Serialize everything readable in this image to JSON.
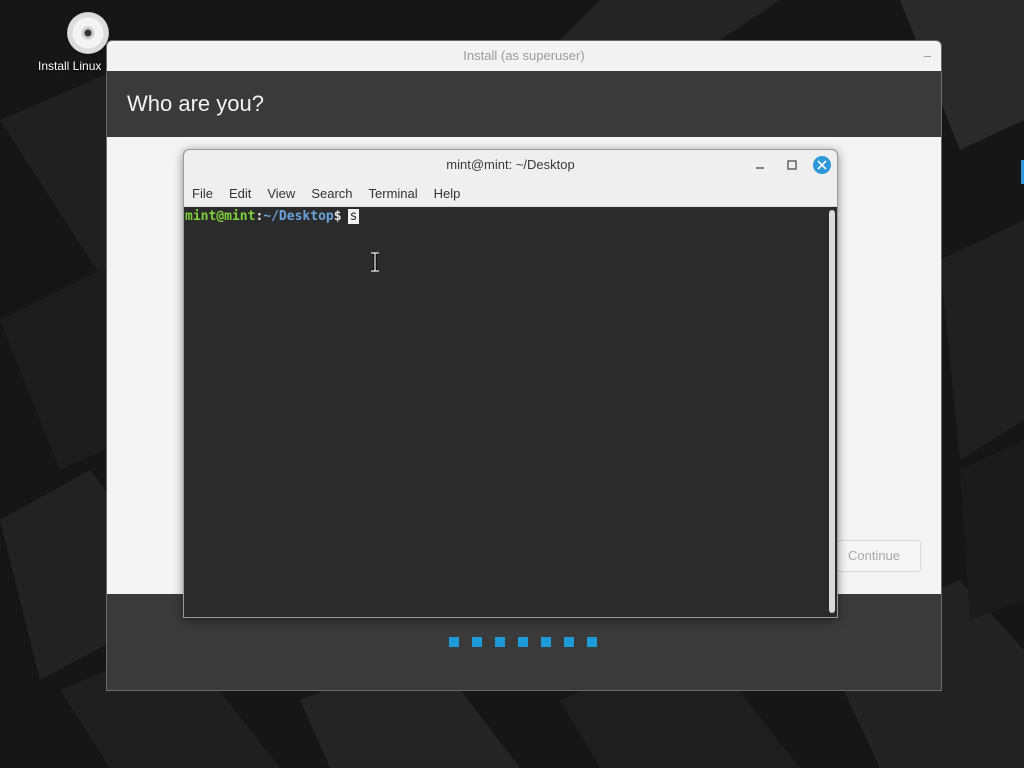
{
  "desktop": {
    "icon_label": "Install Linux"
  },
  "installer": {
    "title": "Install (as superuser)",
    "minimize_glyph": "–",
    "heading": "Who are you?",
    "continue_label": "Continue",
    "progress_steps_total": 7,
    "accent_color": "#1e9ad6"
  },
  "terminal": {
    "title": "mint@mint: ~/Desktop",
    "menu": [
      "File",
      "Edit",
      "View",
      "Search",
      "Terminal",
      "Help"
    ],
    "prompt": {
      "user_host": "mint@mint",
      "colon": ":",
      "path": "~/Desktop",
      "dollar": "$",
      "input": "s"
    },
    "close_button_color": "#2d97d8"
  },
  "icons": [
    "disc-icon",
    "minimize-icon",
    "maximize-icon",
    "close-icon",
    "text-cursor-icon"
  ]
}
